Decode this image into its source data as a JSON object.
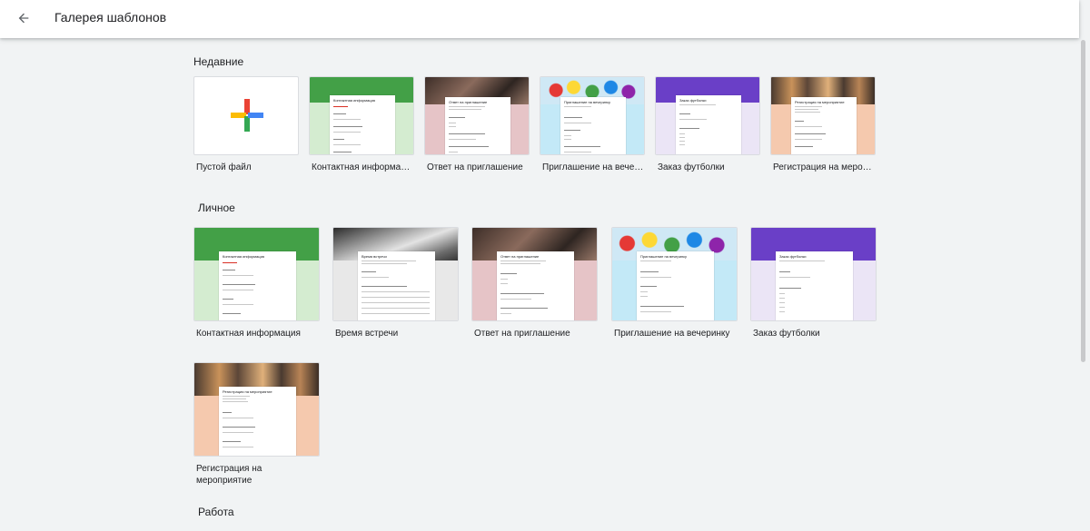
{
  "header": {
    "title": "Галерея шаблонов"
  },
  "sections": {
    "recent": {
      "title": "Недавние"
    },
    "personal": {
      "title": "Личное"
    },
    "work": {
      "title": "Работа"
    }
  },
  "recent_cards": [
    {
      "label": "Пустой файл"
    },
    {
      "label": "Контактная информация",
      "doc_title": "Контактная информация"
    },
    {
      "label": "Ответ на приглашение",
      "doc_title": "Ответ на приглашение"
    },
    {
      "label": "Приглашение на вечеринку",
      "doc_title": "Приглашение на вечеринку"
    },
    {
      "label": "Заказ футболки",
      "doc_title": "Заказ футболки"
    },
    {
      "label": "Регистрация на мероприятие",
      "doc_title": "Регистрация на мероприятие"
    }
  ],
  "personal_cards": [
    {
      "label": "Контактная информация",
      "doc_title": "Контактная информация"
    },
    {
      "label": "Время встречи",
      "doc_title": "Время встречи"
    },
    {
      "label": "Ответ на приглашение",
      "doc_title": "Ответ на приглашение"
    },
    {
      "label": "Приглашение на вечеринку",
      "doc_title": "Приглашение на вечеринку"
    },
    {
      "label": "Заказ футболки",
      "doc_title": "Заказ футболки"
    },
    {
      "label": "Регистрация на мероприятие",
      "doc_title": "Регистрация на мероприятие"
    }
  ],
  "colors": {
    "green": "#43a047",
    "green_light": "#d4ecd0",
    "pink_light": "#e6c4c7",
    "blue_light": "#c3e9f7",
    "purple": "#6a3fc7",
    "purple_light": "#ebe5f6",
    "peach_light": "#f5c9ae",
    "photo_dark": "#5a4b40",
    "photo_gray": "#8d8a86"
  },
  "icons": {
    "back": "arrow-back-icon",
    "blank": "plus-icon"
  }
}
